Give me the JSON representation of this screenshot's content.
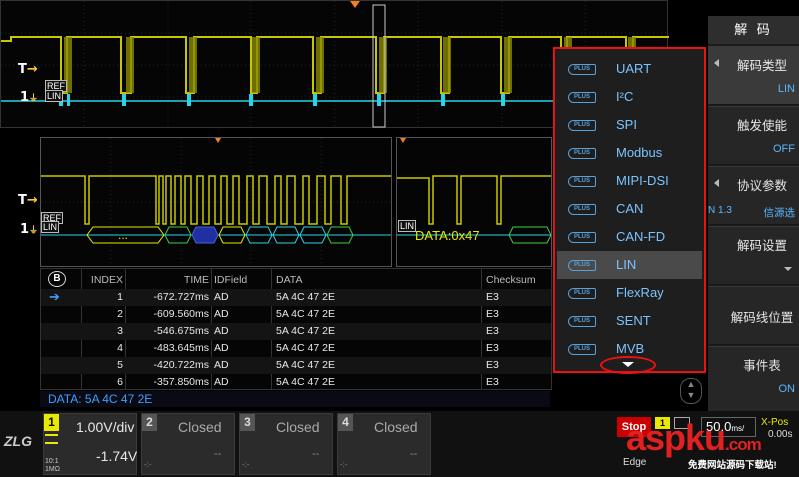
{
  "markers": {
    "trigger_label": "T",
    "ch1_label": "1",
    "lin_tag": "LIN",
    "ref_tag": "REF"
  },
  "zoom": {
    "left_dots": "...",
    "right_data": "DATA:0x47"
  },
  "table": {
    "columns": [
      "INDEX",
      "TIME",
      "IDField",
      "DATA",
      "Checksum"
    ],
    "rows": [
      {
        "index": "1",
        "time": "-672.727ms",
        "id": "AD",
        "data": "5A 4C 47 2E",
        "csum": "E3"
      },
      {
        "index": "2",
        "time": "-609.560ms",
        "id": "AD",
        "data": "5A 4C 47 2E",
        "csum": "E3"
      },
      {
        "index": "3",
        "time": "-546.675ms",
        "id": "AD",
        "data": "5A 4C 47 2E",
        "csum": "E3"
      },
      {
        "index": "4",
        "time": "-483.645ms",
        "id": "AD",
        "data": "5A 4C 47 2E",
        "csum": "E3"
      },
      {
        "index": "5",
        "time": "-420.722ms",
        "id": "AD",
        "data": "5A 4C 47 2E",
        "csum": "E3"
      },
      {
        "index": "6",
        "time": "-357.850ms",
        "id": "AD",
        "data": "5A 4C 47 2E",
        "csum": "E3"
      }
    ],
    "badge": "B"
  },
  "data_bar": "DATA: 5A 4C 47 2E",
  "dropdown": {
    "badge": "PLUS",
    "items": [
      "UART",
      "I²C",
      "SPI",
      "Modbus",
      "MIPI-DSI",
      "CAN",
      "CAN-FD",
      "LIN",
      "FlexRay",
      "SENT",
      "MVB"
    ],
    "selected": "LIN"
  },
  "right_panel": {
    "title": "解 码",
    "decode_type": {
      "label": "解码类型",
      "value": "LIN"
    },
    "trigger_enable": {
      "label": "触发使能",
      "value": "OFF"
    },
    "protocol_params": {
      "label": "协议参数",
      "value_left": "N 1.3",
      "value_right": "信源选"
    },
    "decode_settings": {
      "label": "解码设置"
    },
    "decode_line_pos": {
      "label": "解码线位置"
    },
    "event_table": {
      "label": "事件表",
      "value": "ON"
    }
  },
  "bottom": {
    "ch1": {
      "num": "1",
      "vdiv": "1.00V/div",
      "offset": "-1.74V",
      "sub1": "10:1",
      "sub2": "1MΩ"
    },
    "ch2": {
      "num": "2",
      "status": "Closed",
      "dash": "--",
      "sub": "-:-"
    },
    "ch3": {
      "num": "3",
      "status": "Closed",
      "dash": "--",
      "sub": "-:-"
    },
    "ch4": {
      "num": "4",
      "status": "Closed",
      "dash": "--",
      "sub": "-:-"
    },
    "run_state": "Stop",
    "trig_mode": "Edge",
    "timebase": "50.0",
    "timebase_unit": "ms/",
    "xpos_label": "X-Pos",
    "xpos_value": "0.00s",
    "trig_ch": "1",
    "watermark_main": "aspku",
    "watermark_tld": ".com",
    "watermark_sub": "免费网站源码下载站!"
  },
  "colors": {
    "ch1": "#e8e800",
    "lin": "#2ad4e8",
    "accent": "#3aa0ff",
    "alert": "#e11111"
  }
}
